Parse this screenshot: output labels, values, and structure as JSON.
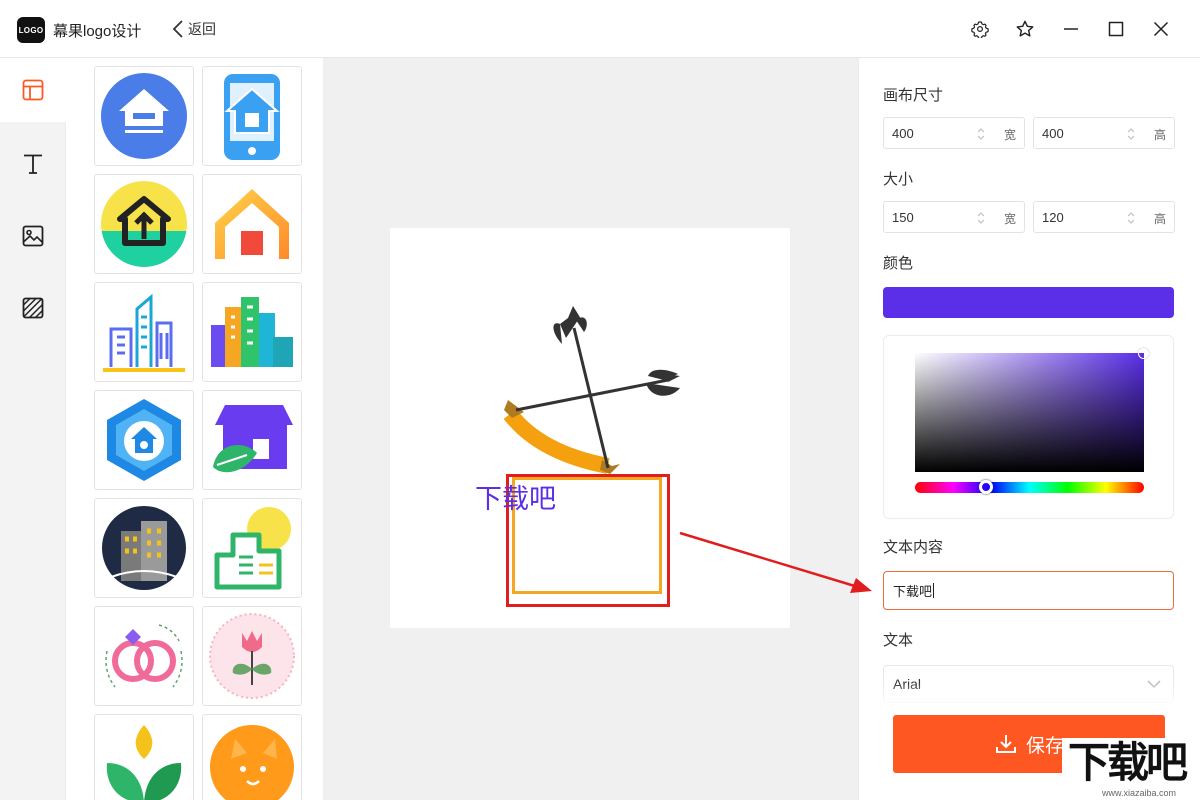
{
  "app": {
    "logo_badge": "LOGO",
    "title": "幕果logo设计",
    "back_label": "返回"
  },
  "window_controls": [
    "gear-icon",
    "star-icon",
    "minimize-icon",
    "maximize-icon",
    "close-icon"
  ],
  "rail": {
    "items": [
      {
        "name": "template",
        "icon": "layout-icon",
        "active": true
      },
      {
        "name": "text",
        "icon": "text-icon",
        "active": false
      },
      {
        "name": "image",
        "icon": "image-icon",
        "active": false
      },
      {
        "name": "background",
        "icon": "hatch-icon",
        "active": false
      }
    ]
  },
  "templates": [
    "house-circle",
    "phone-house",
    "house-arrow",
    "gradient-house",
    "city-outline",
    "color-city",
    "shield-house",
    "store-leaf",
    "building-night",
    "green-building-sun",
    "rings",
    "rose-badge",
    "green-sprout",
    "orange-cat"
  ],
  "canvas": {
    "logo_text": "下载吧",
    "text_color": "#5b2ee8"
  },
  "panel": {
    "canvas_size_label": "画布尺寸",
    "canvas_width": "400",
    "canvas_height": "400",
    "width_unit": "宽",
    "height_unit": "高",
    "size_label": "大小",
    "size_width": "150",
    "size_height": "120",
    "color_label": "颜色",
    "color_value": "#5b2ee8",
    "text_content_label": "文本内容",
    "text_content_value": "下载吧",
    "font_label": "文本",
    "font_value": "Arial",
    "save_label": "保存"
  },
  "watermark": {
    "text": "下载吧",
    "url": "www.xiazaiba.com"
  },
  "colors": {
    "accent": "#ff5722",
    "selection_orange": "#f5a623",
    "annotation_red": "#e01e1e"
  }
}
